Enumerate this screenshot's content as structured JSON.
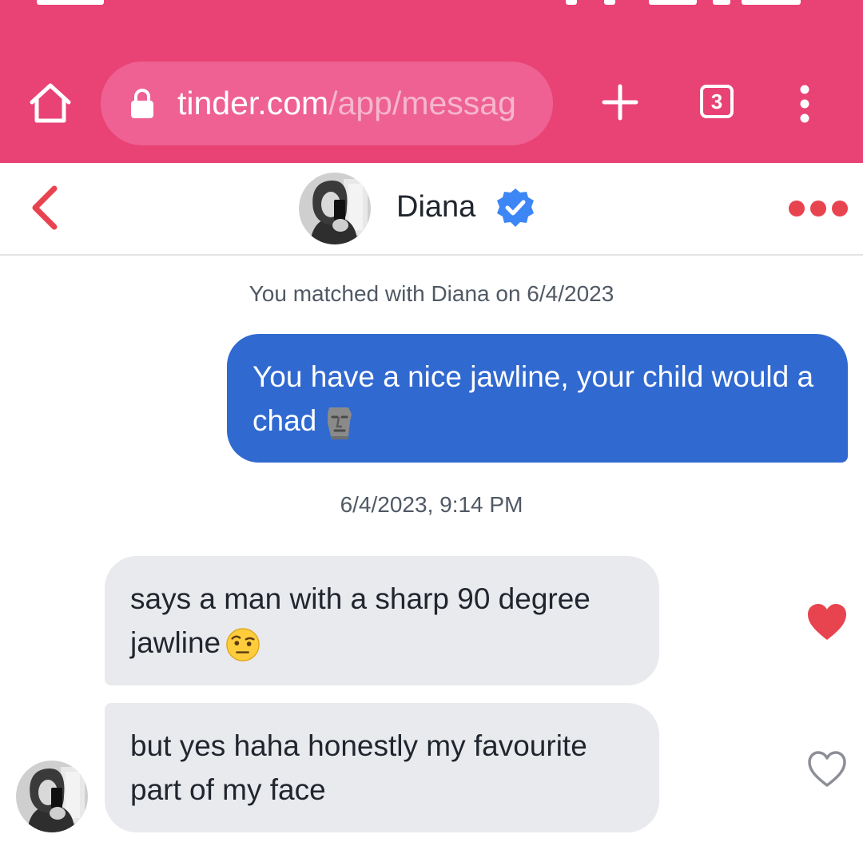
{
  "browser": {
    "url_domain": "tinder.com",
    "url_path": "/app/messag",
    "tab_count": "3",
    "colors": {
      "bar": "#e94275",
      "url_pill": "#ee6192"
    }
  },
  "chat_header": {
    "name": "Diana",
    "icons": [
      "back-chevron-icon",
      "avatar",
      "verified-badge-icon",
      "more-options-icon"
    ],
    "colors": {
      "accent": "#e8444f",
      "verified": "#3d86f5"
    }
  },
  "thread": {
    "match_notice": "You matched with Diana on 6/4/2023",
    "sent_message": {
      "text": "You have a nice jawline, your child would a chad",
      "emoji": "moai-emoji",
      "color": "#3069d0"
    },
    "timestamp": "6/4/2023, 9:14 PM",
    "received_messages": [
      {
        "text": "says a man with a sharp 90 degree jawline",
        "emoji": "face-with-raised-eyebrow-emoji",
        "liked": true
      },
      {
        "text": "but yes haha honestly my favourite part of my face",
        "liked": false
      }
    ],
    "colors": {
      "received_bubble": "#e9eaee",
      "like": "#e8444f"
    }
  }
}
